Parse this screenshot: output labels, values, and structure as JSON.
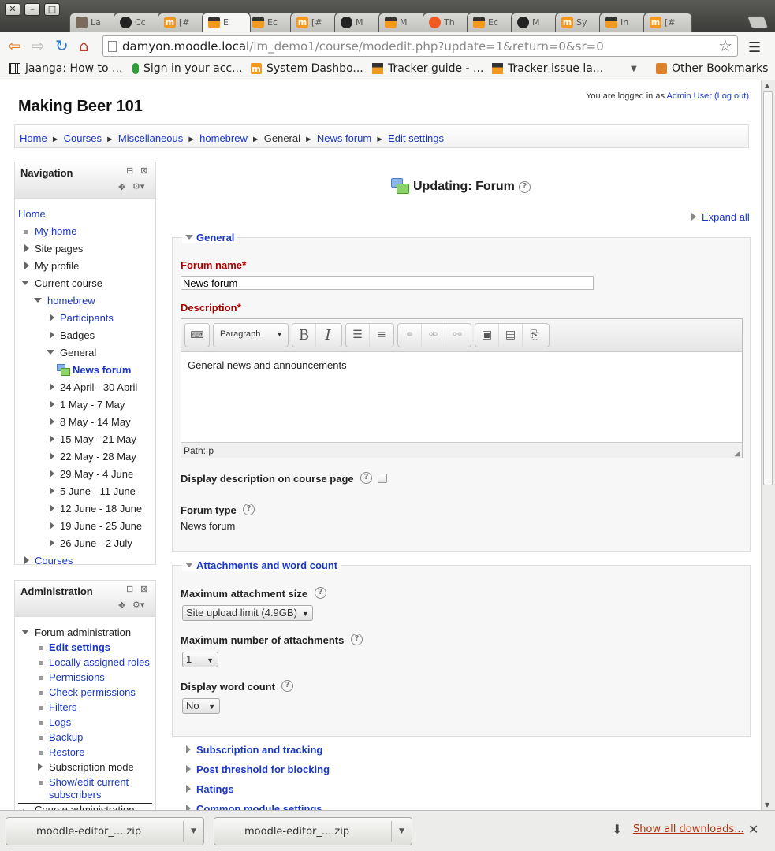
{
  "browser": {
    "window_buttons": [
      "✕",
      "–",
      "□"
    ],
    "tabs": [
      {
        "label": "La",
        "favicon": "avatar"
      },
      {
        "label": "Cc",
        "favicon": "github"
      },
      {
        "label": "[#",
        "favicon": "moodle"
      },
      {
        "label": "E",
        "favicon": "moodle-hat",
        "active": true
      },
      {
        "label": "Ec",
        "favicon": "moodle-hat"
      },
      {
        "label": "[#",
        "favicon": "moodle"
      },
      {
        "label": "M",
        "favicon": "github"
      },
      {
        "label": "M",
        "favicon": "moodle-hat"
      },
      {
        "label": "Th",
        "favicon": "ars"
      },
      {
        "label": "Ec",
        "favicon": "moodle-hat"
      },
      {
        "label": "M",
        "favicon": "github"
      },
      {
        "label": "Sy",
        "favicon": "moodle"
      },
      {
        "label": "In",
        "favicon": "moodle-hat"
      },
      {
        "label": "[#",
        "favicon": "moodle"
      }
    ],
    "url_host": "damyon.moodle.local",
    "url_path": "/im_demo1/course/modedit.php?update=1&return=0&sr=0",
    "bookmarks": [
      {
        "label": "jaanga: How to ...",
        "icon": "barcode-icon"
      },
      {
        "label": "Sign in your acc...",
        "icon": "leaf-icon"
      },
      {
        "label": "System Dashbo...",
        "icon": "moodle-icon"
      },
      {
        "label": "Tracker guide - ...",
        "icon": "moodle-hat-icon"
      },
      {
        "label": "Tracker issue la...",
        "icon": "moodle-hat-icon"
      }
    ],
    "other_bookmarks": "Other Bookmarks"
  },
  "page": {
    "site_title": "Making Beer 101",
    "login_prefix": "You are logged in as ",
    "login_user": "Admin User",
    "logout": "(Log out)",
    "breadcrumbs": [
      "Home",
      "Courses",
      "Miscellaneous",
      "homebrew",
      "General",
      "News forum",
      "Edit settings"
    ],
    "breadcrumb_sep": "►"
  },
  "navigation": {
    "title": "Navigation",
    "home": "Home",
    "my_home": "My home",
    "site_pages": "Site pages",
    "my_profile": "My profile",
    "current_course": "Current course",
    "course": "homebrew",
    "participants": "Participants",
    "badges": "Badges",
    "general": "General",
    "news_forum": "News forum",
    "weeks": [
      "24 April - 30 April",
      "1 May - 7 May",
      "8 May - 14 May",
      "15 May - 21 May",
      "22 May - 28 May",
      "29 May - 4 June",
      "5 June - 11 June",
      "12 June - 18 June",
      "19 June - 25 June",
      "26 June - 2 July"
    ],
    "courses": "Courses"
  },
  "administration": {
    "title": "Administration",
    "forum_admin": "Forum administration",
    "items": [
      "Edit settings",
      "Locally assigned roles",
      "Permissions",
      "Check permissions",
      "Filters",
      "Logs",
      "Backup",
      "Restore"
    ],
    "subscription_mode": "Subscription mode",
    "show_edit_1": "Show/edit current",
    "show_edit_2": "subscribers",
    "course_admin": "Course administration"
  },
  "form": {
    "heading": "Updating: Forum",
    "expand_all": "Expand all",
    "general_legend": "General",
    "forum_name_label": "Forum name",
    "forum_name_value": "News forum",
    "description_label": "Description",
    "paragraph_select": "Paragraph",
    "description_text": "General news and announcements",
    "path": "Path: p",
    "display_desc_label": "Display description on course page",
    "forum_type_label": "Forum type",
    "forum_type_value": "News forum",
    "attach_legend": "Attachments and word count",
    "max_size_label": "Maximum attachment size",
    "max_size_value": "Site upload limit (4.9GB)",
    "max_num_label": "Maximum number of attachments",
    "max_num_value": "1",
    "word_count_label": "Display word count",
    "word_count_value": "No",
    "collapsed_sections": [
      "Subscription and tracking",
      "Post threshold for blocking",
      "Ratings",
      "Common module settings"
    ]
  },
  "downloads": {
    "items": [
      "moodle-editor_....zip",
      "moodle-editor_....zip"
    ],
    "show_all": "Show all downloads..."
  },
  "colors": {
    "link": "#1a38c8",
    "required": "#aa0000",
    "moodle_orange": "#f29a1f"
  }
}
